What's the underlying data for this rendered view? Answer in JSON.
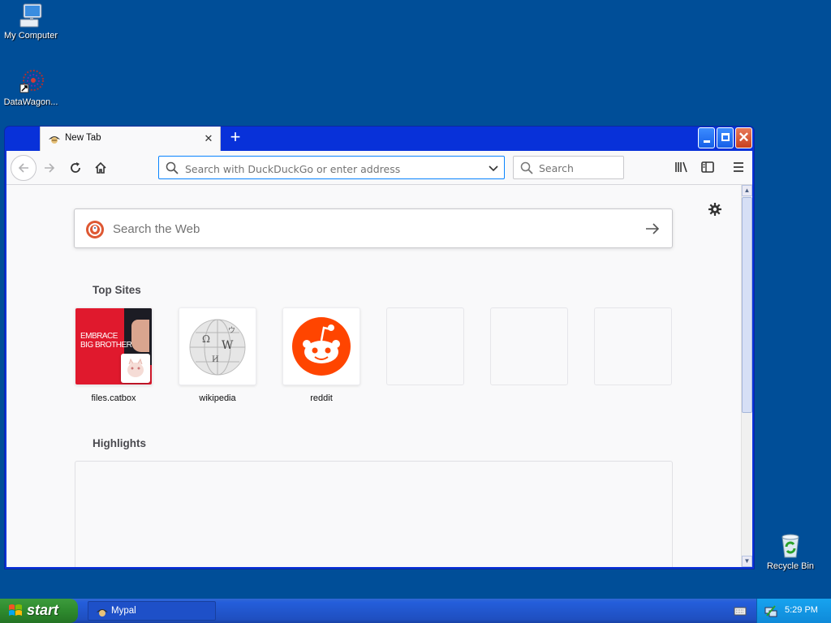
{
  "desktop": {
    "icons": [
      {
        "label": "My Computer"
      },
      {
        "label": "DataWagon..."
      },
      {
        "label": "Recycle Bin"
      }
    ]
  },
  "browser": {
    "tab_title": "New Tab",
    "urlbar_placeholder": "Search with DuckDuckGo or enter address",
    "searchbar_placeholder": "Search",
    "web_search_placeholder": "Search the Web",
    "top_sites_title": "Top Sites",
    "highlights_title": "Highlights",
    "top_sites": [
      {
        "name": "files.catbox",
        "tile_text_1": "EMBRACE",
        "tile_text_2": "BIG BROTHER"
      },
      {
        "name": "wikipedia"
      },
      {
        "name": "reddit"
      },
      {
        "name": ""
      },
      {
        "name": ""
      },
      {
        "name": ""
      }
    ]
  },
  "taskbar": {
    "start_label": "start",
    "task_label": "Mypal",
    "clock": "5:29 PM"
  },
  "colors": {
    "desktop_bg": "#004e98",
    "titlebar_blue": "#0831d9",
    "url_focus": "#0a84ff",
    "reddit_orange": "#ff4500",
    "start_green": "#2e8a2e",
    "tray_blue": "#0f8ad9"
  }
}
